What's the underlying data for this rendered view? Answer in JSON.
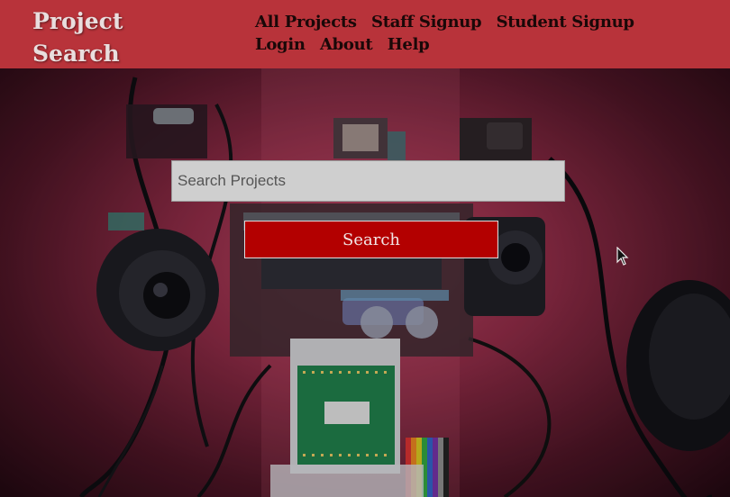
{
  "brand": {
    "line1": "Project",
    "line2": "Search"
  },
  "nav": {
    "items": [
      {
        "label": "All Projects"
      },
      {
        "label": "Staff Signup"
      },
      {
        "label": "Student Signup"
      },
      {
        "label": "Login"
      },
      {
        "label": "About"
      },
      {
        "label": "Help"
      }
    ]
  },
  "search": {
    "placeholder": "Search Projects",
    "value": "",
    "button_label": "Search"
  },
  "colors": {
    "header_bg": "#b8333a",
    "button_bg": "#b30000"
  },
  "icons": {
    "pointer": "mouse-pointer-icon"
  }
}
